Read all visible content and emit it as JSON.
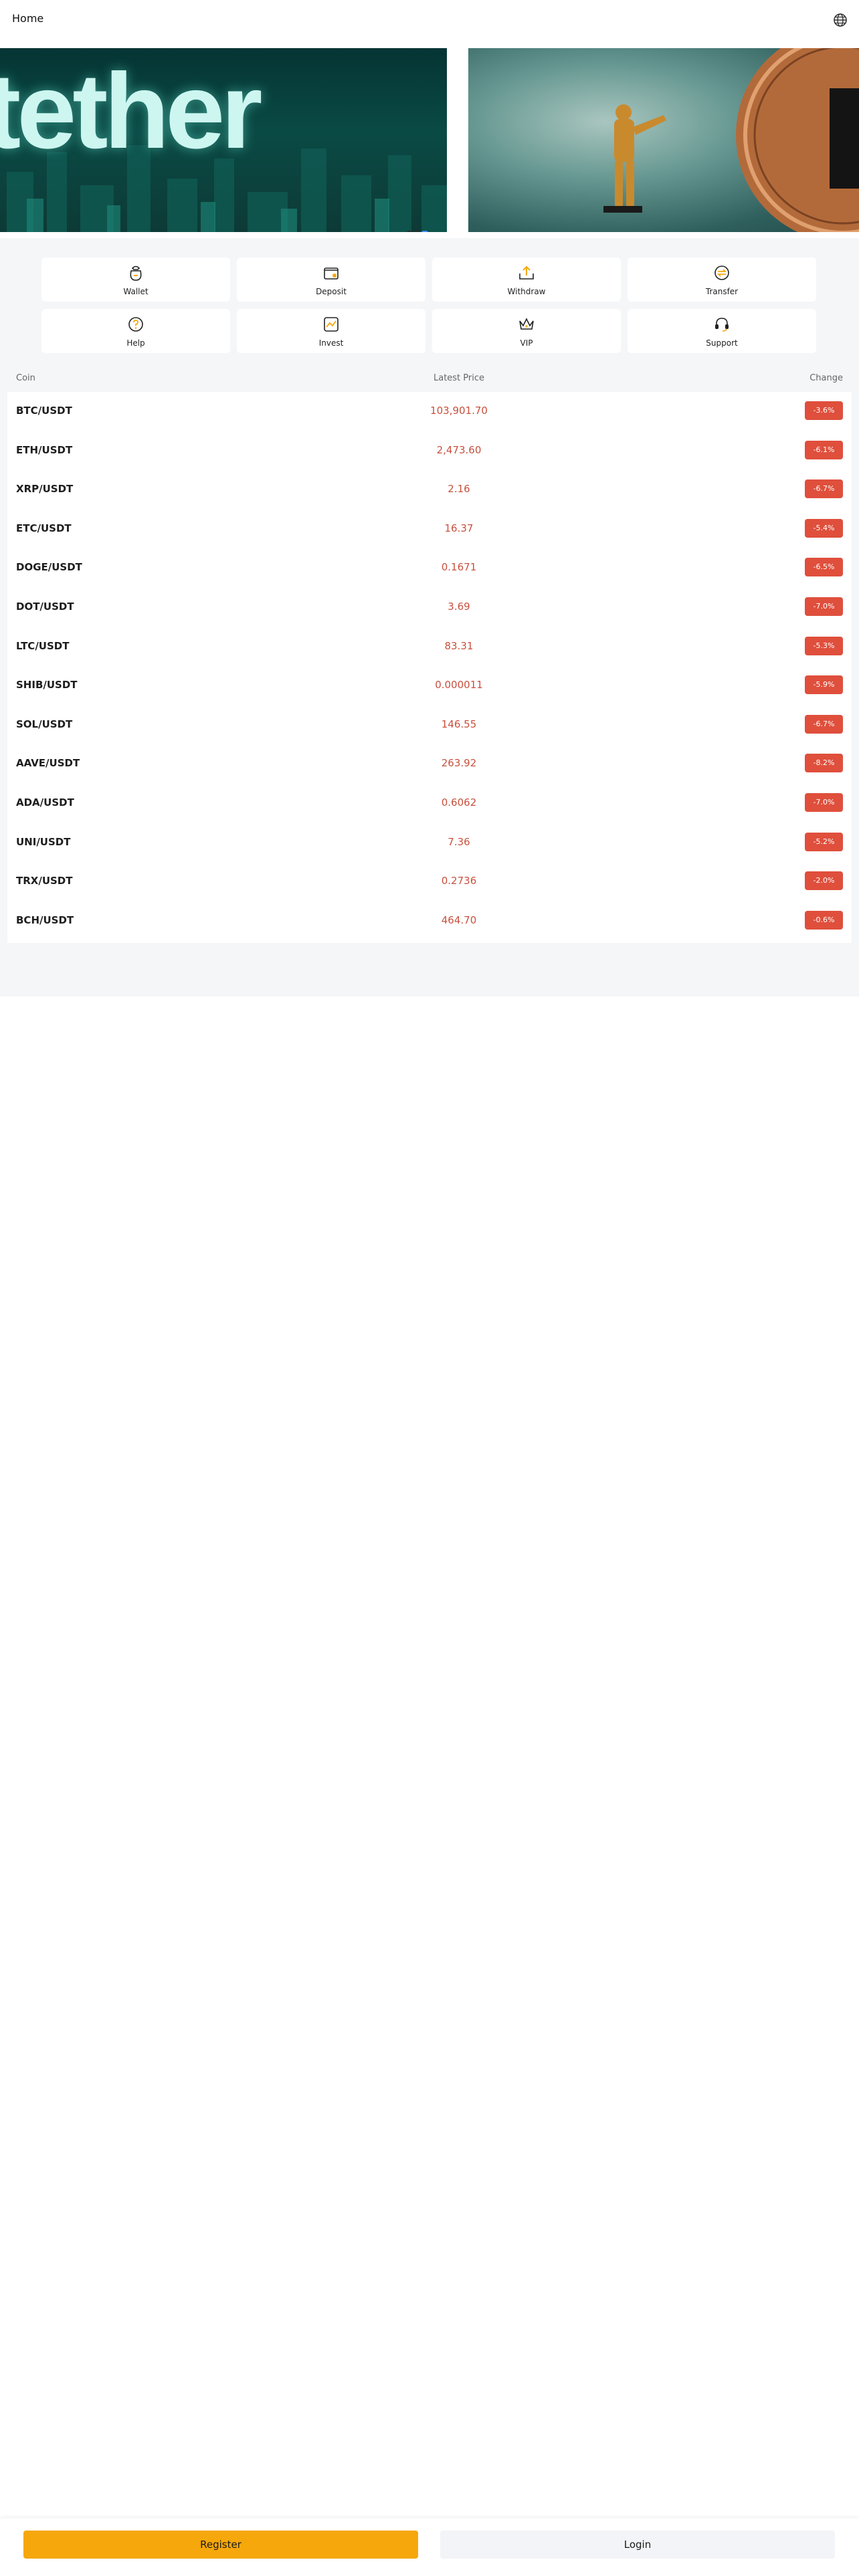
{
  "header": {
    "title": "Home",
    "language_icon": "globe-icon"
  },
  "banner": {
    "slides": [
      {
        "text": "tether"
      },
      {
        "text": ""
      }
    ],
    "dot_count": 3,
    "active_dot": 2
  },
  "quick_actions": [
    {
      "label": "Wallet",
      "icon": "wallet-icon"
    },
    {
      "label": "Deposit",
      "icon": "deposit-icon"
    },
    {
      "label": "Withdraw",
      "icon": "withdraw-icon"
    },
    {
      "label": "Transfer",
      "icon": "transfer-icon"
    },
    {
      "label": "Help",
      "icon": "help-icon"
    },
    {
      "label": "Invest",
      "icon": "invest-icon"
    },
    {
      "label": "VIP",
      "icon": "crown-icon"
    },
    {
      "label": "Support",
      "icon": "headset-icon"
    }
  ],
  "market": {
    "headers": {
      "coin": "Coin",
      "price": "Latest Price",
      "change": "Change"
    },
    "rows": [
      {
        "coin": "BTC/USDT",
        "price": "103,901.70",
        "change": "-3.6%"
      },
      {
        "coin": "ETH/USDT",
        "price": "2,473.60",
        "change": "-6.1%"
      },
      {
        "coin": "XRP/USDT",
        "price": "2.16",
        "change": "-6.7%"
      },
      {
        "coin": "ETC/USDT",
        "price": "16.37",
        "change": "-5.4%"
      },
      {
        "coin": "DOGE/USDT",
        "price": "0.1671",
        "change": "-6.5%"
      },
      {
        "coin": "DOT/USDT",
        "price": "3.69",
        "change": "-7.0%"
      },
      {
        "coin": "LTC/USDT",
        "price": "83.31",
        "change": "-5.3%"
      },
      {
        "coin": "SHIB/USDT",
        "price": "0.000011",
        "change": "-5.9%"
      },
      {
        "coin": "SOL/USDT",
        "price": "146.55",
        "change": "-6.7%"
      },
      {
        "coin": "AAVE/USDT",
        "price": "263.92",
        "change": "-8.2%"
      },
      {
        "coin": "ADA/USDT",
        "price": "0.6062",
        "change": "-7.0%"
      },
      {
        "coin": "UNI/USDT",
        "price": "7.36",
        "change": "-5.2%"
      },
      {
        "coin": "TRX/USDT",
        "price": "0.2736",
        "change": "-2.0%"
      },
      {
        "coin": "BCH/USDT",
        "price": "464.70",
        "change": "-0.6%"
      }
    ]
  },
  "footer": {
    "register_label": "Register",
    "login_label": "Login"
  },
  "colors": {
    "accent": "#f6a70b",
    "negative": "#df4f3c",
    "price_text": "#c8503d",
    "page_background": "#f5f6f8"
  }
}
